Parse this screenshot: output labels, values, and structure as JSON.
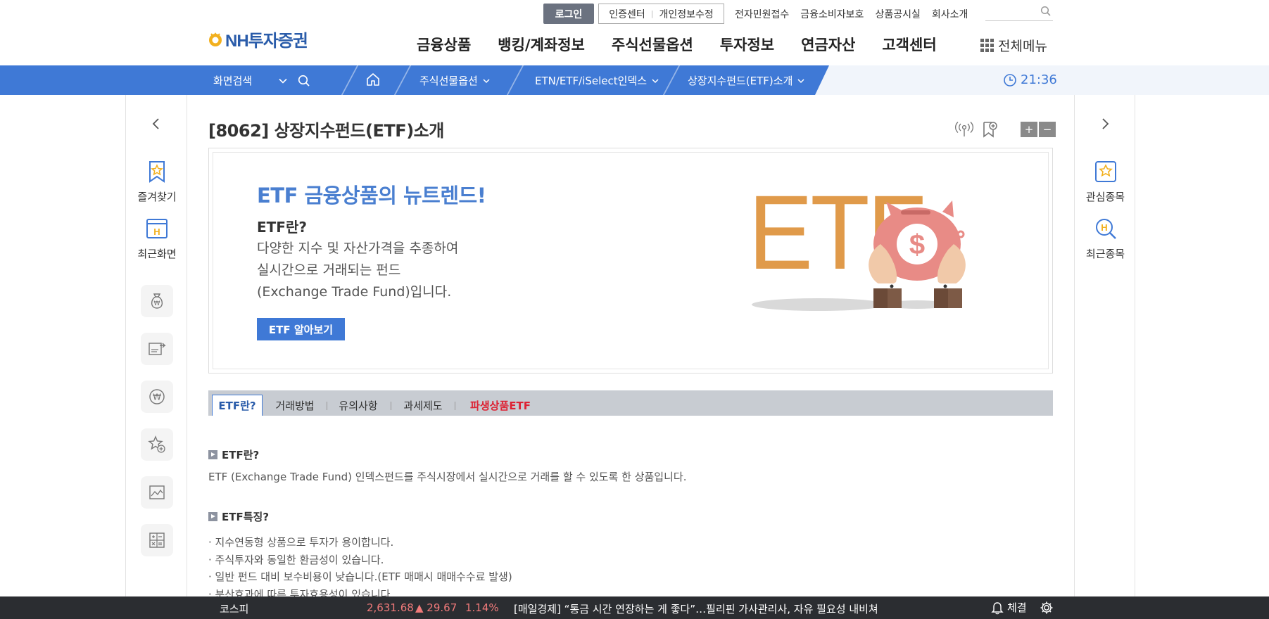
{
  "header": {
    "logo_text": "NH투자증권",
    "login_label": "로그인",
    "cert_label": "인증센터",
    "privacy_label": "개인정보수정",
    "util_links": [
      "전자민원접수",
      "금융소비자보호",
      "상품공시실",
      "회사소개"
    ],
    "gnb": [
      "금융상품",
      "뱅킹/계좌정보",
      "주식선물옵션",
      "투자정보",
      "연금자산",
      "고객센터"
    ],
    "allmenu_label": "전체메뉴"
  },
  "navbar": {
    "search_label": "화면검색",
    "crumbs": [
      "주식선물옵션",
      "ETN/ETF/iSelect인덱스",
      "상장지수펀드(ETF)소개"
    ],
    "clock": "21:36",
    "accent": "#3f79d6"
  },
  "left_rail": {
    "favorites_label": "즐겨찾기",
    "recent_label": "최근화면",
    "recent_badge": "H"
  },
  "right_rail": {
    "watch_label": "관심종목",
    "recent_label": "최근종목",
    "recent_badge": "H"
  },
  "page": {
    "title": "[8062] 상장지수펀드(ETF)소개",
    "zoom_in": "+",
    "zoom_out": "−"
  },
  "banner": {
    "headline": "ETF 금융상품의 뉴트렌드!",
    "subhead": "ETF란?",
    "desc_lines": [
      "다양한 지수 및 자산가격을 추종하여",
      "실시간으로 거래되는 펀드",
      "(Exchange Trade Fund)입니다."
    ],
    "button": "ETF 알아보기",
    "art_text": "ETF",
    "art_symbol": "$"
  },
  "tabs": [
    "ETF란?",
    "거래방법",
    "유의사항",
    "과세제도",
    "파생상품ETF"
  ],
  "sections": {
    "s1_title": "ETF란?",
    "s1_text": "ETF (Exchange Trade Fund) 인덱스펀드를 주식시장에서 실시간으로 거래를 할 수 있도록 한 상품입니다.",
    "s2_title": "ETF특징?",
    "s2_items": [
      "지수연동형 상품으로 투자가 용이합니다.",
      "주식투자와 동일한 환금성이 있습니다.",
      "일반 펀드 대비 보수비용이 낮습니다.(ETF 매매시 매매수수료 발생)",
      "분산효과에 따른 투자효용성이 있습니다."
    ]
  },
  "ticker": {
    "index_name": "코스피",
    "index_value": "2,631.68",
    "change": "▲ 29.67",
    "change_pct": "1.14%",
    "news": "[매일경제]  “통금 시간 연장하는 게 좋다”…필리핀 가사관리사, 자유 필요성 내비쳐",
    "alert_label": "체결"
  }
}
